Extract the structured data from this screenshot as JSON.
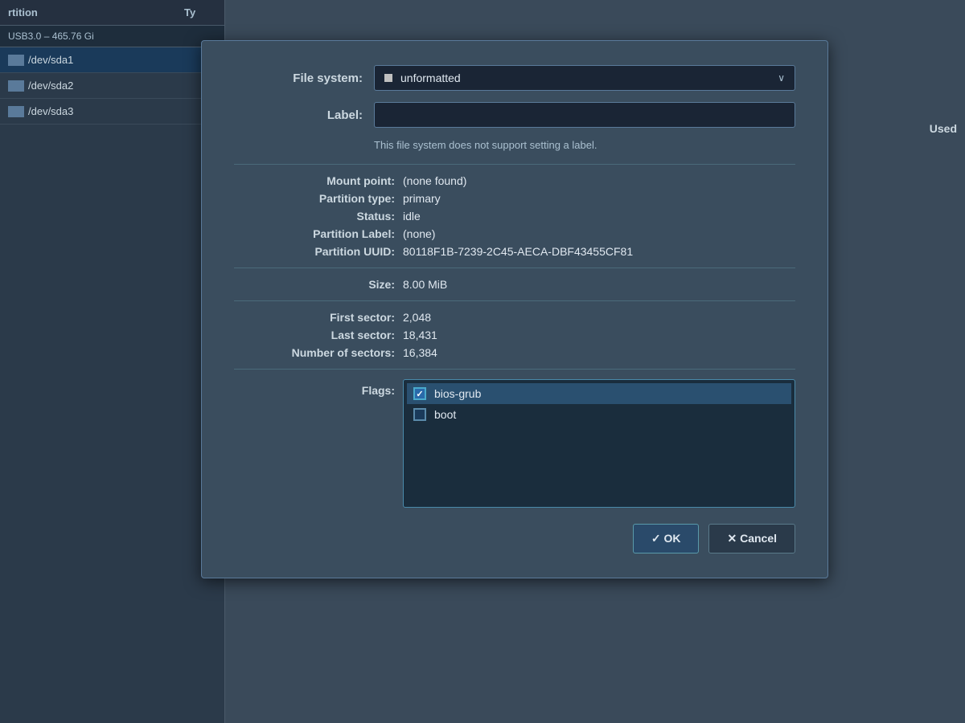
{
  "background": {
    "used_label": "Used",
    "header": {
      "partition_col": "rtition",
      "type_col": "Ty"
    },
    "disk": {
      "label": "USB3.0 – 465.76 Gi"
    },
    "partitions": [
      {
        "name": "/dev/sda1",
        "selected": true
      },
      {
        "name": "/dev/sda2",
        "selected": false
      },
      {
        "name": "/dev/sda3",
        "selected": false
      }
    ]
  },
  "dialog": {
    "filesystem": {
      "label": "File system:",
      "value": "unformatted",
      "chevron": "∨"
    },
    "label_field": {
      "label": "Label:",
      "value": "",
      "placeholder": ""
    },
    "helper_text": "This file system does not support setting a label.",
    "info_rows": [
      {
        "label": "Mount point:",
        "value": "(none found)"
      },
      {
        "label": "Partition type:",
        "value": "primary"
      },
      {
        "label": "Status:",
        "value": "idle"
      },
      {
        "label": "Partition Label:",
        "value": "(none)"
      },
      {
        "label": "Partition UUID:",
        "value": "80118F1B-7239-2C45-AECA-DBF43455CF81"
      },
      {
        "label": "Size:",
        "value": "8.00 MiB"
      },
      {
        "label": "First sector:",
        "value": "2,048"
      },
      {
        "label": "Last sector:",
        "value": "18,431"
      },
      {
        "label": "Number of sectors:",
        "value": "16,384"
      }
    ],
    "flags": {
      "label": "Flags:",
      "items": [
        {
          "name": "bios-grub",
          "checked": true
        },
        {
          "name": "boot",
          "checked": false
        }
      ]
    },
    "buttons": {
      "ok_label": "✓ OK",
      "cancel_label": "✕ Cancel"
    }
  }
}
